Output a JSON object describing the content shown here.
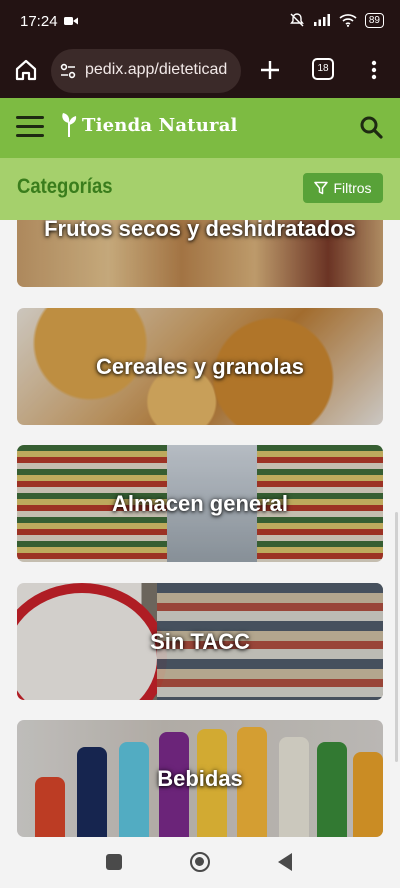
{
  "status_bar": {
    "time": "17:24",
    "battery": "89"
  },
  "browser": {
    "url": "pedix.app/dieteticad",
    "tab_count": "18"
  },
  "app": {
    "brand": "Tienda Natural"
  },
  "categories_bar": {
    "title": "Categorías",
    "filter_label": "Filtros"
  },
  "categories": [
    {
      "label": "Frutos secos y deshidratados"
    },
    {
      "label": "Cereales y granolas"
    },
    {
      "label": "Almacen general"
    },
    {
      "label": "Sin TACC"
    },
    {
      "label": "Bebidas"
    }
  ],
  "colors": {
    "header_green": "#7dbb42",
    "category_bar_green": "#a5d06c",
    "filter_button": "#58a238",
    "browser_bg": "#231313"
  },
  "icons": [
    "video-record-icon",
    "mute-icon",
    "signal-icon",
    "wifi-icon",
    "battery-icon",
    "home-icon",
    "site-settings-icon",
    "plus-icon",
    "tabs-icon",
    "more-icon",
    "hamburger-icon",
    "leaf-logo-icon",
    "search-icon",
    "filter-icon"
  ]
}
